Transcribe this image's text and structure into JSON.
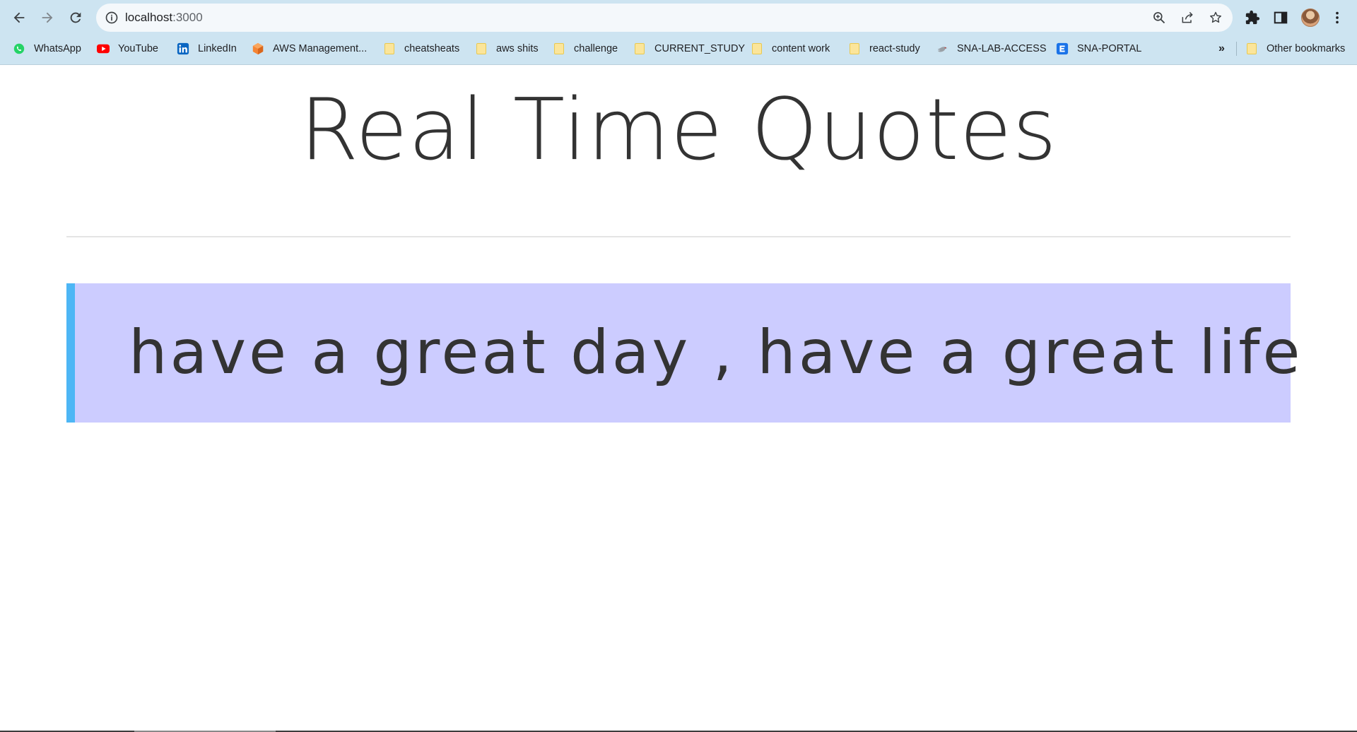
{
  "browser": {
    "url_host": "localhost",
    "url_port": ":3000",
    "more_bookmarks_label": "»",
    "other_bookmarks_label": "Other bookmarks",
    "bookmarks": [
      {
        "label": "WhatsApp",
        "icon": "whatsapp-icon",
        "color": "#25d366"
      },
      {
        "label": "YouTube",
        "icon": "youtube-icon",
        "color": "#ff0000"
      },
      {
        "label": "LinkedIn",
        "icon": "linkedin-icon",
        "color": "#0a66c2"
      },
      {
        "label": "AWS Management...",
        "icon": "aws-cube-icon",
        "color": "#f58534"
      },
      {
        "label": "cheatsheats",
        "icon": "folder-icon"
      },
      {
        "label": "aws shits",
        "icon": "folder-icon"
      },
      {
        "label": "challenge",
        "icon": "folder-icon"
      },
      {
        "label": "CURRENT_STUDY",
        "icon": "folder-icon"
      },
      {
        "label": "content work",
        "icon": "folder-icon"
      },
      {
        "label": "react-study",
        "icon": "folder-icon"
      },
      {
        "label": "SNA-LAB-ACCESS",
        "icon": "bird-icon"
      },
      {
        "label": "SNA-PORTAL",
        "icon": "portal-icon",
        "color": "#1a73e8"
      }
    ]
  },
  "page": {
    "title": "Real Time Quotes",
    "quote": "have a great day , have a great life"
  }
}
